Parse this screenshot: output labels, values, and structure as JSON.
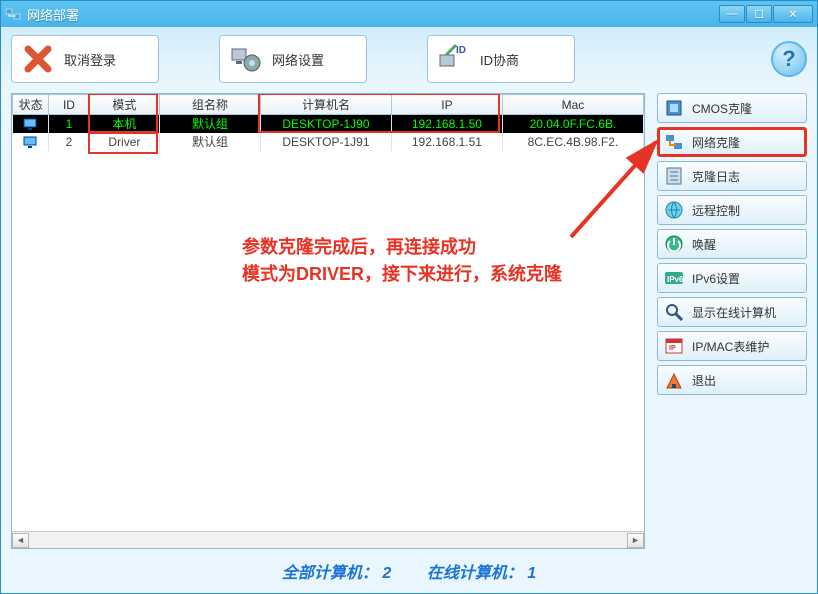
{
  "window": {
    "title": "网络部署"
  },
  "toolbar": {
    "cancel_login": "取消登录",
    "network_settings": "网络设置",
    "id_negotiate": "ID协商"
  },
  "table": {
    "headers": {
      "status": "状态",
      "id": "ID",
      "mode": "模式",
      "group": "组名称",
      "computer": "计算机名",
      "ip": "IP",
      "mac": "Mac"
    },
    "rows": [
      {
        "id": "1",
        "mode": "本机",
        "group": "默认组",
        "computer": "DESKTOP-1J90",
        "ip": "192.168.1.50",
        "mac": "20.04.0F.FC.6B."
      },
      {
        "id": "2",
        "mode": "Driver",
        "group": "默认组",
        "computer": "DESKTOP-1J91",
        "ip": "192.168.1.51",
        "mac": "8C.EC.4B.98.F2."
      }
    ]
  },
  "sidebar": {
    "items": [
      {
        "label": "CMOS克隆"
      },
      {
        "label": "网络克隆"
      },
      {
        "label": "克隆日志"
      },
      {
        "label": "远程控制"
      },
      {
        "label": "唤醒"
      },
      {
        "label": "IPv6设置"
      },
      {
        "label": "显示在线计算机"
      },
      {
        "label": "IP/MAC表维护"
      },
      {
        "label": "退出"
      }
    ]
  },
  "annotation": {
    "line1": "参数克隆完成后，再连接成功",
    "line2": "模式为DRIVER，接下来进行，系统克隆"
  },
  "status": {
    "total_label": "全部计算机：",
    "total_value": "2",
    "online_label": "在线计算机：",
    "online_value": "1"
  }
}
